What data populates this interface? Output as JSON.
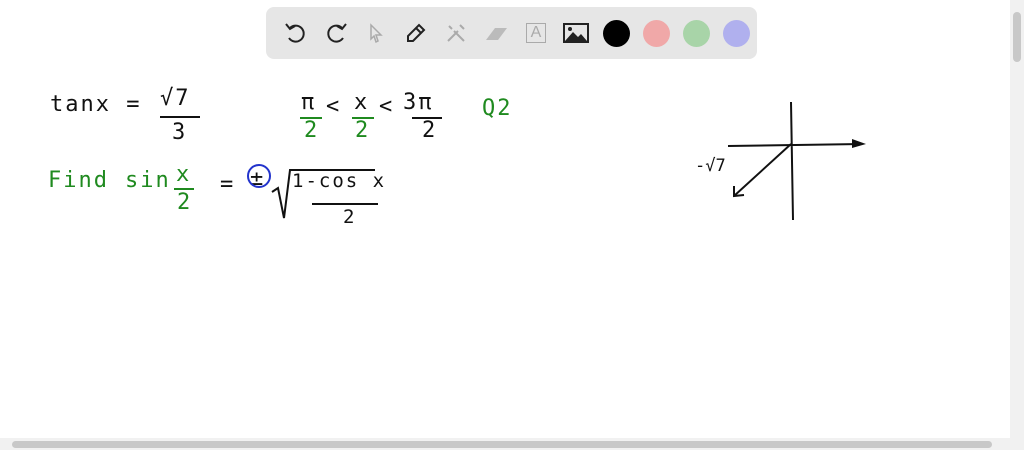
{
  "toolbar": {
    "tools": [
      {
        "name": "undo-icon",
        "enabled": true
      },
      {
        "name": "redo-icon",
        "enabled": true
      },
      {
        "name": "select-icon",
        "enabled": false
      },
      {
        "name": "pen-icon",
        "enabled": true
      },
      {
        "name": "tools-icon",
        "enabled": false
      },
      {
        "name": "eraser-icon",
        "enabled": false
      },
      {
        "name": "text-icon",
        "enabled": false
      },
      {
        "name": "image-icon",
        "enabled": true
      }
    ],
    "text_tool_label": "A",
    "colors": [
      "#000000",
      "#f0a8a8",
      "#a8d4a8",
      "#b0b0ee"
    ]
  },
  "canvas": {
    "line1": {
      "lhs": "tanx =",
      "num": "√7",
      "den": "3"
    },
    "range": {
      "a_num": "π",
      "a_den": "2",
      "lt1": "<",
      "b_num": "x",
      "b_den": "2",
      "lt2": "<",
      "c_num": "3π",
      "c_den": "2"
    },
    "label": "Q2",
    "line2": {
      "find": "Find",
      "sin": "sin",
      "x_num": "x",
      "x_den": "2",
      "eq": "=",
      "pm": "±",
      "rad_num": "1-cos x",
      "rad_den": "2"
    },
    "graph_label": "-√7"
  },
  "colors": {
    "ink": "#111111",
    "green": "#1f8a1f",
    "blue": "#2233cc"
  }
}
